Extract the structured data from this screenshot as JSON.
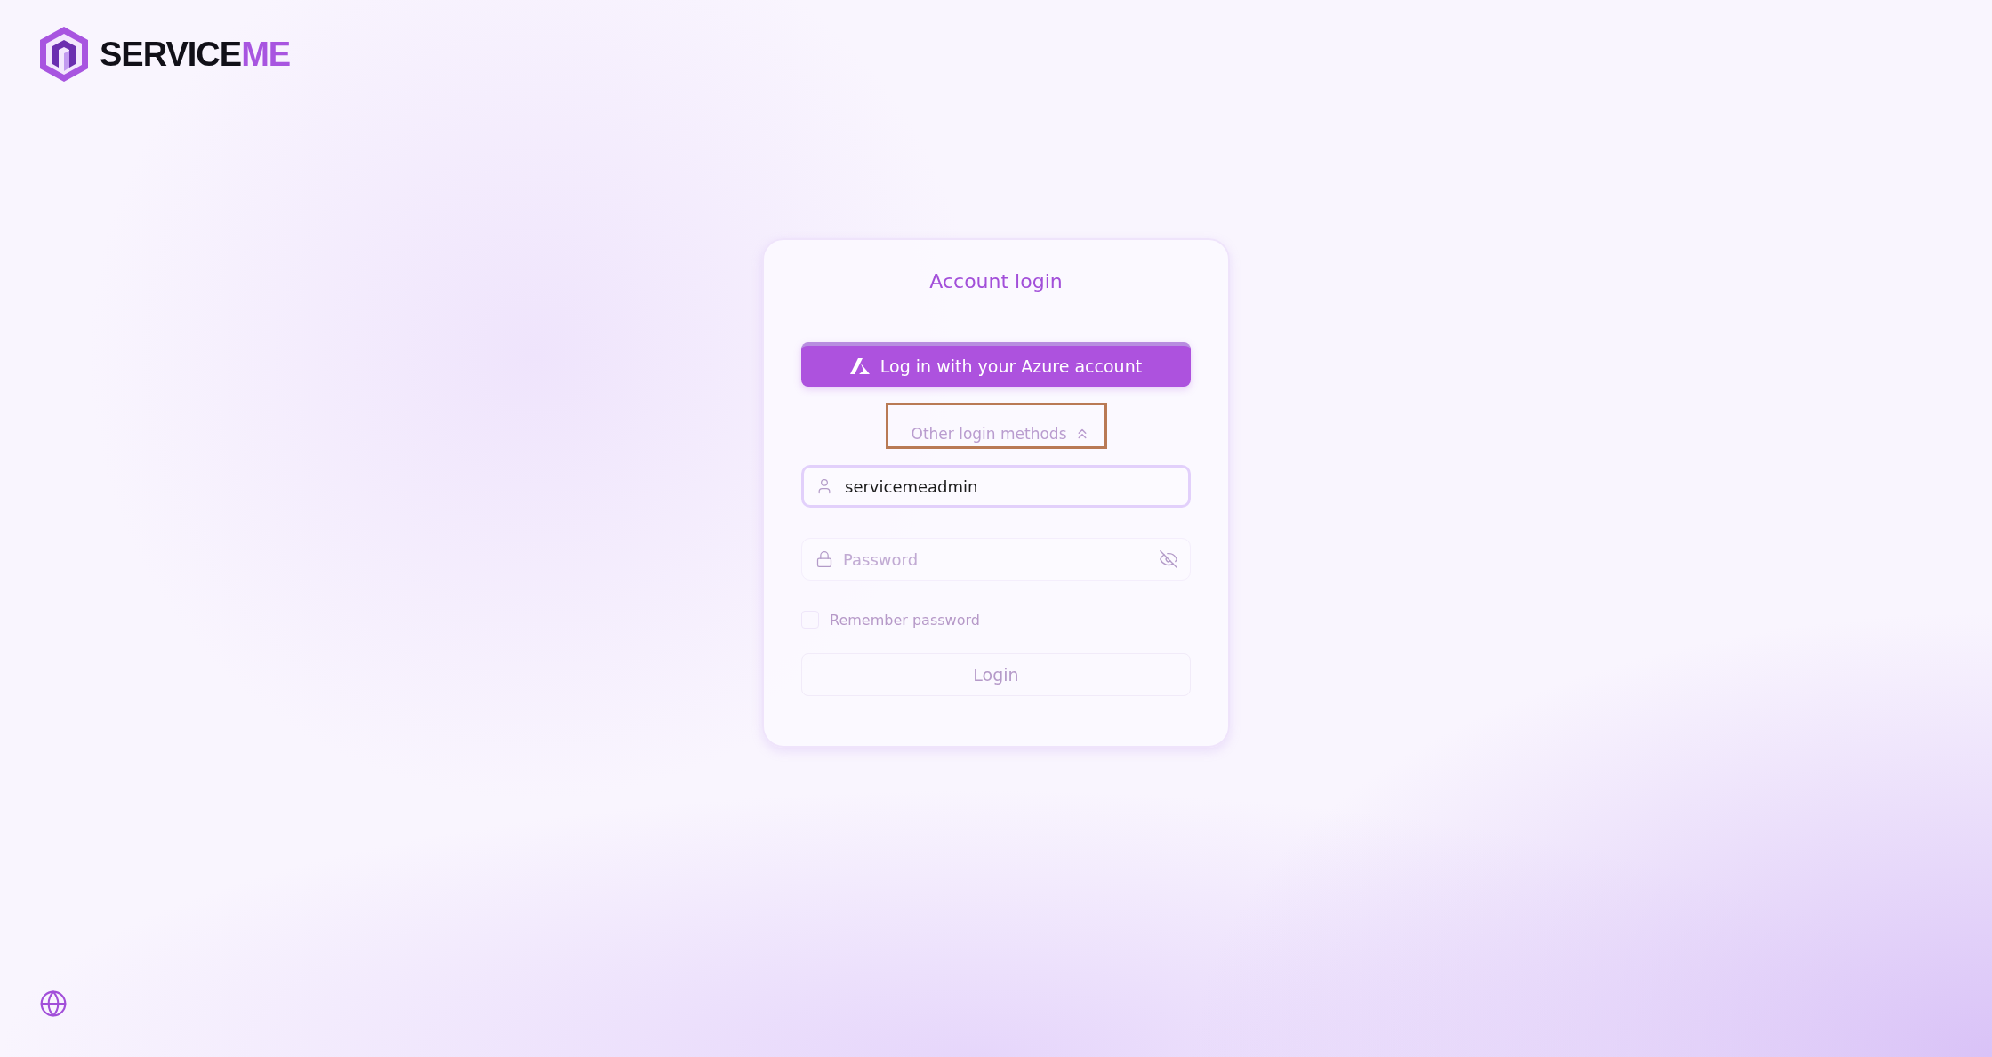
{
  "logo": {
    "text": "SERVICE",
    "accent": "ME"
  },
  "login_card": {
    "title": "Account login",
    "azure_button": "Log in with your Azure account",
    "other_methods": {
      "label": "Other login methods",
      "expanded": true,
      "highlighted": true
    },
    "username": {
      "value": "servicemeadmin"
    },
    "password": {
      "placeholder": "Password",
      "visible": false
    },
    "remember": {
      "label": "Remember password",
      "checked": false
    },
    "login_button": "Login"
  }
}
